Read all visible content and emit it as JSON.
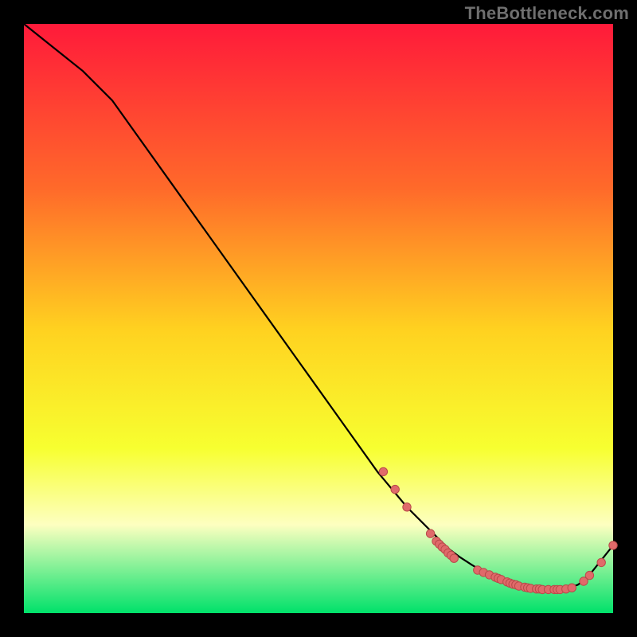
{
  "watermark": "TheBottleneck.com",
  "colors": {
    "background": "#000000",
    "gradient_top": "#ff1a3a",
    "gradient_mid_upper": "#ff6a2a",
    "gradient_mid": "#ffd220",
    "gradient_mid_lower": "#f7ff30",
    "gradient_pale_yellow": "#fdffc0",
    "gradient_bottom": "#00e16a",
    "curve": "#000000",
    "marker_fill": "#e06a6a",
    "marker_stroke": "#b94a4a"
  },
  "chart_data": {
    "type": "line",
    "title": "",
    "xlabel": "",
    "ylabel": "",
    "xlim": [
      0,
      100
    ],
    "ylim": [
      0,
      100
    ],
    "grid": false,
    "legend": false,
    "series": [
      {
        "name": "bottleneck-curve",
        "x": [
          0,
          5,
          10,
          15,
          20,
          25,
          30,
          35,
          40,
          45,
          50,
          55,
          60,
          65,
          70,
          72,
          74,
          76,
          78,
          80,
          82,
          84,
          86,
          88,
          90,
          92,
          94,
          95,
          96,
          98,
          100
        ],
        "y": [
          100,
          96,
          92,
          87,
          80,
          73,
          66,
          59,
          52,
          45,
          38,
          31,
          24,
          18,
          13,
          11,
          9.5,
          8.2,
          7.0,
          6.0,
          5.2,
          4.6,
          4.2,
          4.0,
          4.0,
          4.2,
          4.8,
          5.5,
          6.5,
          9.0,
          11.5
        ]
      }
    ],
    "scatter_clusters": [
      {
        "name": "cluster-left-slope",
        "points": [
          [
            69,
            13.5
          ],
          [
            70,
            12.2
          ],
          [
            70.5,
            11.7
          ],
          [
            71,
            11.2
          ],
          [
            71.5,
            10.8
          ],
          [
            72,
            10.2
          ],
          [
            72.5,
            9.8
          ],
          [
            73,
            9.3
          ],
          [
            61,
            24
          ],
          [
            63,
            21
          ],
          [
            65,
            18
          ]
        ]
      },
      {
        "name": "cluster-valley",
        "points": [
          [
            77,
            7.3
          ],
          [
            78,
            6.9
          ],
          [
            79,
            6.5
          ],
          [
            80,
            6.1
          ],
          [
            80.5,
            5.9
          ],
          [
            81,
            5.7
          ],
          [
            82,
            5.3
          ],
          [
            82.5,
            5.1
          ],
          [
            83,
            4.9
          ],
          [
            83.5,
            4.8
          ],
          [
            84,
            4.6
          ],
          [
            85,
            4.4
          ],
          [
            85.5,
            4.3
          ],
          [
            86,
            4.2
          ],
          [
            87,
            4.1
          ],
          [
            87.5,
            4.1
          ],
          [
            88,
            4.0
          ],
          [
            89,
            4.0
          ],
          [
            90,
            4.0
          ],
          [
            90.5,
            4.0
          ],
          [
            91,
            4.0
          ],
          [
            92,
            4.1
          ],
          [
            93,
            4.3
          ]
        ]
      },
      {
        "name": "cluster-right-rise",
        "points": [
          [
            95,
            5.4
          ],
          [
            96,
            6.4
          ],
          [
            100,
            11.5
          ],
          [
            98,
            8.6
          ]
        ]
      }
    ]
  }
}
